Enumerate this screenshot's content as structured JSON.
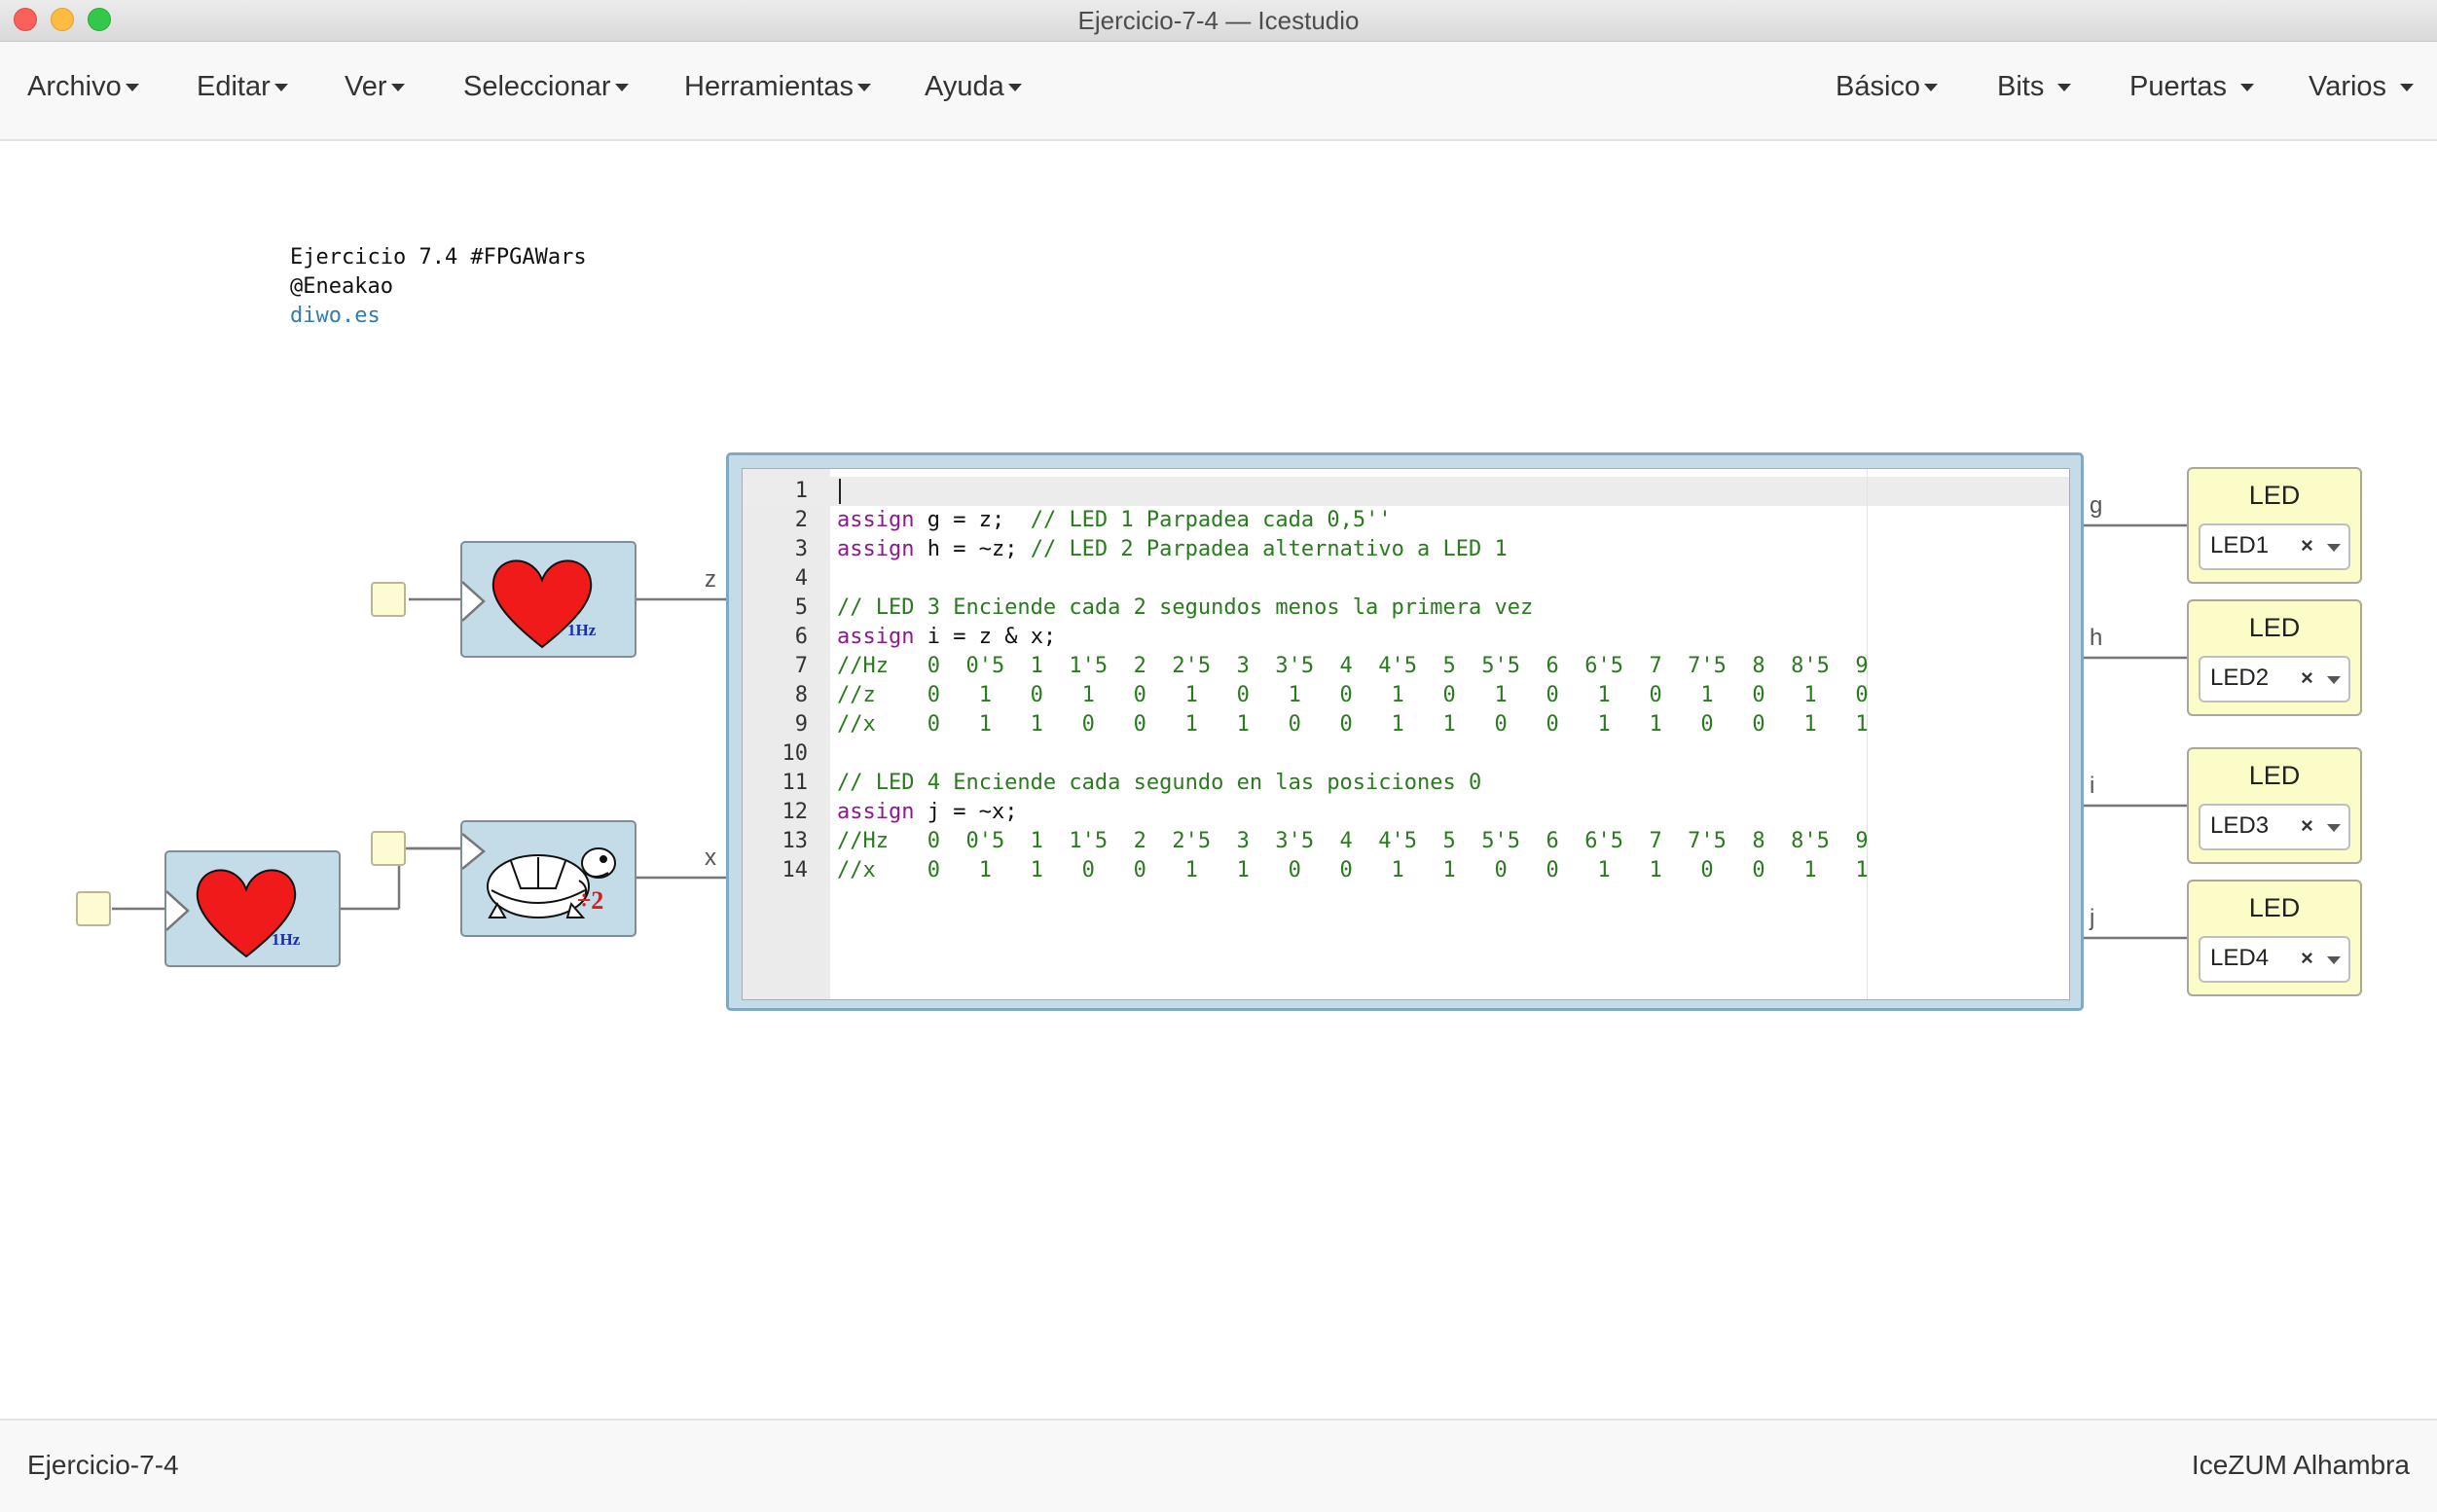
{
  "window": {
    "title": "Ejercicio-7-4 — Icestudio"
  },
  "menubar": {
    "left": [
      "Archivo",
      "Editar",
      "Ver",
      "Seleccionar",
      "Herramientas",
      "Ayuda"
    ],
    "right": [
      "Básico",
      "Bits",
      "Puertas",
      "Varios"
    ]
  },
  "note": {
    "line1": "Ejercicio 7.4 #FPGAWars",
    "line2": "@Eneakao",
    "link": "diwo.es"
  },
  "blocks": {
    "heart_top": {
      "freq": "1Hz"
    },
    "heart_bottom": {
      "freq": "1Hz"
    },
    "divider": {
      "label": "÷2"
    }
  },
  "wires": {
    "z": "z",
    "x": "x",
    "g": "g",
    "h": "h",
    "i": "i",
    "j": "j"
  },
  "code": {
    "lines": [
      {
        "n": "1",
        "kw": "",
        "text": "",
        "comment": ""
      },
      {
        "n": "2",
        "kw": "assign",
        "text": " g = z;  ",
        "comment": "// LED 1 Parpadea cada 0,5''"
      },
      {
        "n": "3",
        "kw": "assign",
        "text": " h = ~z; ",
        "comment": "// LED 2 Parpadea alternativo a LED 1"
      },
      {
        "n": "4",
        "kw": "",
        "text": "",
        "comment": ""
      },
      {
        "n": "5",
        "kw": "",
        "text": "",
        "comment": "// LED 3 Enciende cada 2 segundos menos la primera vez"
      },
      {
        "n": "6",
        "kw": "assign",
        "text": " i = z & x;",
        "comment": ""
      },
      {
        "n": "7",
        "kw": "",
        "text": "",
        "comment": "//Hz   0  0'5  1  1'5  2  2'5  3  3'5  4  4'5  5  5'5  6  6'5  7  7'5  8  8'5  9"
      },
      {
        "n": "8",
        "kw": "",
        "text": "",
        "comment": "//z    0   1   0   1   0   1   0   1   0   1   0   1   0   1   0   1   0   1   0"
      },
      {
        "n": "9",
        "kw": "",
        "text": "",
        "comment": "//x    0   1   1   0   0   1   1   0   0   1   1   0   0   1   1   0   0   1   1"
      },
      {
        "n": "10",
        "kw": "",
        "text": "",
        "comment": ""
      },
      {
        "n": "11",
        "kw": "",
        "text": "",
        "comment": "// LED 4 Enciende cada segundo en las posiciones 0"
      },
      {
        "n": "12",
        "kw": "assign",
        "text": " j = ~x;",
        "comment": ""
      },
      {
        "n": "13",
        "kw": "",
        "text": "",
        "comment": "//Hz   0  0'5  1  1'5  2  2'5  3  3'5  4  4'5  5  5'5  6  6'5  7  7'5  8  8'5  9"
      },
      {
        "n": "14",
        "kw": "",
        "text": "",
        "comment": "//x    0   1   1   0   0   1   1   0   0   1   1   0   0   1   1   0   0   1   1"
      }
    ]
  },
  "leds": [
    {
      "title": "LED",
      "value": "LED1",
      "clear": "×"
    },
    {
      "title": "LED",
      "value": "LED2",
      "clear": "×"
    },
    {
      "title": "LED",
      "value": "LED3",
      "clear": "×"
    },
    {
      "title": "LED",
      "value": "LED4",
      "clear": "×"
    }
  ],
  "footer": {
    "left": "Ejercicio-7-4",
    "right": "IceZUM Alhambra"
  },
  "colors": {
    "block_bg": "#c3dce8",
    "led_bg": "#fcfcc8",
    "stub_bg": "#fdfbd2",
    "keyword": "#8b1a8e",
    "comment": "#2a7a1f",
    "link": "#337ab7"
  }
}
